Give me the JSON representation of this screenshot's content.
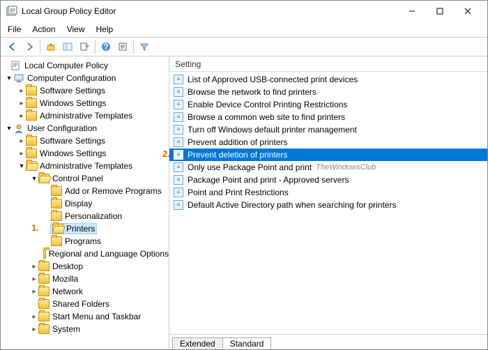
{
  "window": {
    "title": "Local Group Policy Editor"
  },
  "menubar": [
    "File",
    "Action",
    "View",
    "Help"
  ],
  "tree": {
    "root": "Local Computer Policy",
    "cc": "Computer Configuration",
    "cc_sw": "Software Settings",
    "cc_win": "Windows Settings",
    "cc_adm": "Administrative Templates",
    "uc": "User Configuration",
    "uc_sw": "Software Settings",
    "uc_win": "Windows Settings",
    "uc_adm": "Administrative Templates",
    "cp": "Control Panel",
    "cp_add": "Add or Remove Programs",
    "cp_disp": "Display",
    "cp_pers": "Personalization",
    "cp_prn": "Printers",
    "cp_prog": "Programs",
    "cp_reg": "Regional and Language Options",
    "desk": "Desktop",
    "moz": "Mozilla",
    "net": "Network",
    "shf": "Shared Folders",
    "stt": "Start Menu and Taskbar",
    "sys": "System"
  },
  "listHeader": "Setting",
  "settings": [
    "List of Approved USB-connected print devices",
    "Browse the network to find printers",
    "Enable Device Control Printing Restrictions",
    "Browse a common web site to find printers",
    "Turn off Windows default printer management",
    "Prevent addition of printers",
    "Prevent deletion of printers",
    "Only use Package Point and print",
    "Package Point and print - Approved servers",
    "Point and Print Restrictions",
    "Default Active Directory path when searching for printers"
  ],
  "watermark": "TheWindowsClub",
  "callouts": {
    "one": "1.",
    "two": "2."
  },
  "tabs": {
    "ext": "Extended",
    "std": "Standard"
  }
}
